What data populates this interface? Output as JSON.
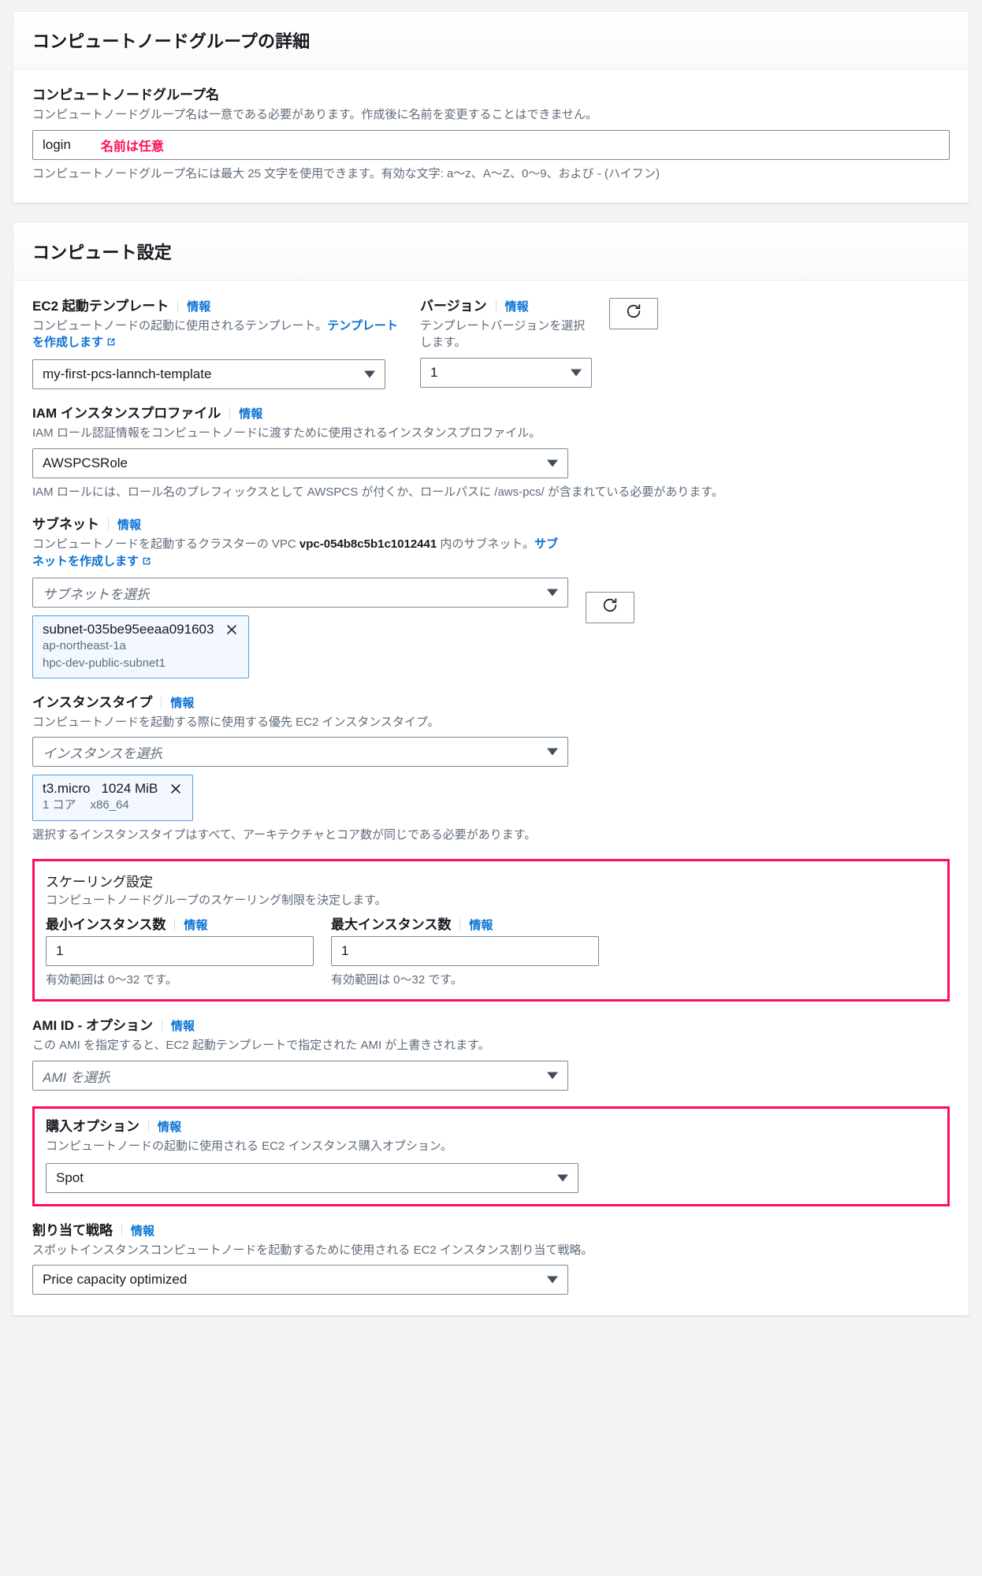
{
  "details_card": {
    "title": "コンピュートノードグループの詳細",
    "name_field": {
      "label": "コンピュートノードグループ名",
      "description": "コンピュートノードグループ名は一意である必要があります。作成後に名前を変更することはできません。",
      "value": "login",
      "annotation": "名前は任意",
      "hint": "コンピュートノードグループ名には最大 25 文字を使用できます。有効な文字: a〜z、A〜Z、0〜9、および - (ハイフン)"
    }
  },
  "compute_card": {
    "title": "コンピュート設定",
    "info_label": "情報",
    "launch_template": {
      "label": "EC2 起動テンプレート",
      "description_pre": "コンピュートノードの起動に使用されるテンプレート。",
      "description_link": "テンプレートを作成します",
      "value": "my-first-pcs-lannch-template"
    },
    "version": {
      "label": "バージョン",
      "description": "テンプレートバージョンを選択します。",
      "value": "1"
    },
    "iam_profile": {
      "label": "IAM インスタンスプロファイル",
      "description": "IAM ロール認証情報をコンピュートノードに渡すために使用されるインスタンスプロファイル。",
      "value": "AWSPCSRole",
      "hint": "IAM ロールには、ロール名のプレフィックスとして AWSPCS が付くか、ロールパスに /aws-pcs/ が含まれている必要があります。"
    },
    "subnet": {
      "label": "サブネット",
      "description_pre": "コンピュートノードを起動するクラスターの VPC ",
      "vpc_id": "vpc-054b8c5b1c1012441",
      "description_mid": " 内のサブネット。",
      "description_link": "サブネットを作成します",
      "placeholder": "サブネットを選択",
      "token": {
        "id": "subnet-035be95eeaa091603",
        "az": "ap-northeast-1a",
        "name": "hpc-dev-public-subnet1"
      }
    },
    "instance_type": {
      "label": "インスタンスタイプ",
      "description": "コンピュートノードを起動する際に使用する優先 EC2 インスタンスタイプ。",
      "placeholder": "インスタンスを選択",
      "token": {
        "name": "t3.micro",
        "memory": "1024 MiB",
        "cores": "1 コア",
        "arch": "x86_64"
      },
      "hint": "選択するインスタンスタイプはすべて、アーキテクチャとコア数が同じである必要があります。"
    },
    "scaling": {
      "title": "スケーリング設定",
      "description": "コンピュートノードグループのスケーリング制限を決定します。",
      "min": {
        "label": "最小インスタンス数",
        "value": "1",
        "hint": "有効範囲は 0〜32 です。"
      },
      "max": {
        "label": "最大インスタンス数",
        "value": "1",
        "hint": "有効範囲は 0〜32 です。"
      }
    },
    "ami_id": {
      "label": "AMI ID - オプション",
      "description": "この AMI を指定すると、EC2 起動テンプレートで指定された AMI が上書きされます。",
      "placeholder": "AMI を選択"
    },
    "purchase_option": {
      "label": "購入オプション",
      "description": "コンピュートノードの起動に使用される EC2 インスタンス購入オプション。",
      "value": "Spot"
    },
    "allocation_strategy": {
      "label": "割り当て戦略",
      "description": "スポットインスタンスコンピュートノードを起動するために使用される EC2 インスタンス割り当て戦略。",
      "value": "Price capacity optimized"
    }
  },
  "colors": {
    "link": "#0972d3",
    "annotation": "#ff0d55",
    "border": "#7d8998",
    "token_border": "#539fe5",
    "token_bg": "#f2f8fd"
  }
}
